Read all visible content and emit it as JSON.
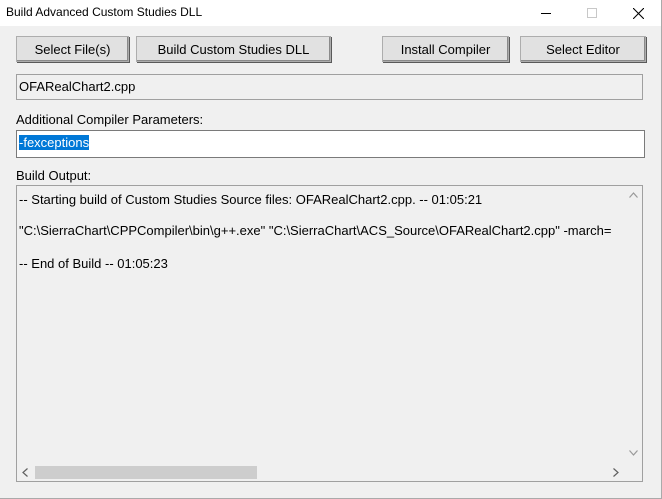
{
  "window": {
    "title": "Build Advanced Custom Studies DLL"
  },
  "toolbar": {
    "select_files": "Select File(s)",
    "build_dll": "Build Custom Studies DLL",
    "install_compiler": "Install Compiler",
    "select_editor": "Select Editor"
  },
  "selected_file": "OFARealChart2.cpp",
  "compiler_params": {
    "label": "Additional Compiler Parameters:",
    "value": "-fexceptions"
  },
  "build_output": {
    "label": "Build Output:",
    "lines": [
      "-- Starting build of Custom Studies Source files: OFARealChart2.cpp. --     01:05:21",
      "\"C:\\SierraChart\\CPPCompiler\\bin\\g++.exe\" \"C:\\SierraChart\\ACS_Source\\OFARealChart2.cpp\"  -march=",
      "-- End of Build --     01:05:23"
    ]
  },
  "icons": {
    "minimize": "minimize-icon",
    "maximize": "maximize-icon",
    "close": "close-icon",
    "scroll_up": "chevron-up-icon",
    "scroll_down": "chevron-down-icon",
    "scroll_left": "chevron-left-icon",
    "scroll_right": "chevron-right-icon"
  }
}
